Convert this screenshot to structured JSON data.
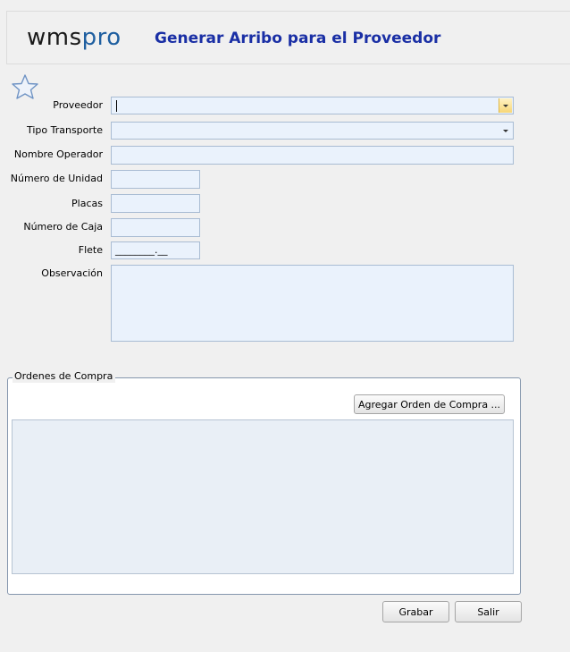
{
  "header": {
    "logo_part1": "wms",
    "logo_part2": "pro",
    "title": "Generar Arribo para el Proveedor"
  },
  "form": {
    "proveedor": {
      "label": "Proveedor",
      "value": ""
    },
    "tipo_transporte": {
      "label": "Tipo Transporte",
      "value": ""
    },
    "nombre_operador": {
      "label": "Nombre Operador",
      "value": ""
    },
    "numero_unidad": {
      "label": "Número de Unidad",
      "value": ""
    },
    "placas": {
      "label": "Placas",
      "value": ""
    },
    "numero_caja": {
      "label": "Número de Caja",
      "value": ""
    },
    "flete": {
      "label": "Flete",
      "mask": "________.__"
    },
    "observacion": {
      "label": "Observación",
      "value": ""
    }
  },
  "ordenes": {
    "legend": "Ordenes de Compra",
    "add_button": "Agregar Orden de Compra ..."
  },
  "footer": {
    "save_button": "Grabar",
    "exit_button": "Salir"
  },
  "icons": {
    "favorite": "star-icon",
    "dropdown": "chevron-down-icon"
  },
  "colors": {
    "title": "#1a2fa5",
    "field_bg": "#eaf2fc",
    "field_border": "#a9bcd3",
    "dropdown_highlight": "#f7d676"
  }
}
